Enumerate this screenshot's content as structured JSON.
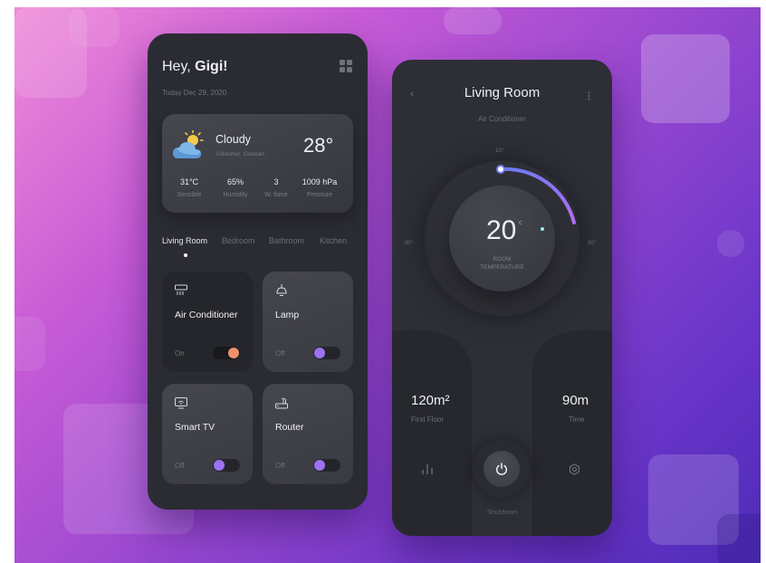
{
  "phone_home": {
    "greeting_prefix": "Hey, ",
    "greeting_name": "Gigi!",
    "date": "Today Dec 29, 2020",
    "weather": {
      "condition": "Cloudy",
      "location": "Sidoluhur, Godean",
      "temperature": "28°",
      "stats": [
        {
          "value": "31°C",
          "label": "Sensible"
        },
        {
          "value": "65%",
          "label": "Humidity"
        },
        {
          "value": "3",
          "label": "W. force"
        },
        {
          "value": "1009 hPa",
          "label": "Pressure"
        }
      ]
    },
    "rooms": [
      "Living Room",
      "Bedroom",
      "Bathroom",
      "Kitchen"
    ],
    "active_room": "Living Room",
    "devices": [
      {
        "name": "Air Conditioner",
        "state": "On",
        "icon": "air-conditioner-icon"
      },
      {
        "name": "Lamp",
        "state": "Off",
        "icon": "lamp-icon"
      },
      {
        "name": "Smart TV",
        "state": "Off",
        "icon": "tv-icon"
      },
      {
        "name": "Router",
        "state": "Off",
        "icon": "router-icon"
      }
    ]
  },
  "phone_room": {
    "title": "Living Room",
    "subtitle": "Air Conditioner",
    "dial": {
      "min_label": "-30°",
      "top_label": "10°",
      "max_label": "30°",
      "value": "20",
      "unit": "c",
      "caption_line1": "ROOM",
      "caption_line2": "TEMPERATURE"
    },
    "area": {
      "value": "120m²",
      "label": "First Floor"
    },
    "time": {
      "value": "90m",
      "label": "Time"
    },
    "power_label": "Shutdown"
  },
  "colors": {
    "panel": "#2b2c33",
    "accent_purple": "#9b72f0",
    "accent_orange": "#f0906e",
    "accent_cyan": "#9be9f0"
  }
}
